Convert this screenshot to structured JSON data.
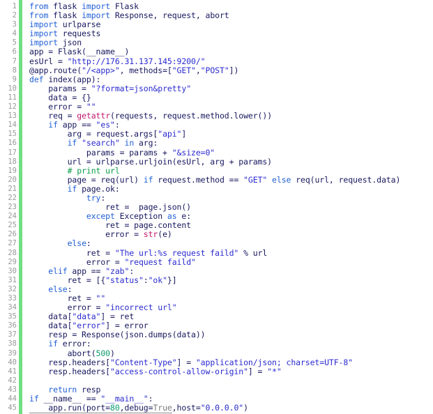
{
  "window": {
    "title": "flask app.py",
    "language": "Python",
    "theme": "light",
    "colors": {
      "background": "#ffffff",
      "gutter_text": "#999999",
      "change_marker": "#6ee083",
      "keyword": "#1f5fd6",
      "builtin": "#c2176b",
      "string": "#2a2ad0",
      "number": "#0b9d6e",
      "comment": "#0b9d4a",
      "constant": "#7a7a7a",
      "plain": "#17175e"
    }
  },
  "editor": {
    "first_line_number": 1,
    "last_line_number": 45,
    "total_lines": 45,
    "line_numbers": [
      "1",
      "2",
      "3",
      "4",
      "5",
      "6",
      "7",
      "8",
      "9",
      "10",
      "11",
      "12",
      "13",
      "14",
      "15",
      "16",
      "17",
      "18",
      "19",
      "20",
      "21",
      "22",
      "23",
      "24",
      "25",
      "26",
      "27",
      "28",
      "29",
      "30",
      "31",
      "32",
      "33",
      "34",
      "35",
      "36",
      "37",
      "38",
      "39",
      "40",
      "41",
      "42",
      "43",
      "44",
      "45"
    ],
    "lines": [
      "from flask import Flask",
      "from flask import Response, request, abort",
      "import urlparse",
      "import requests",
      "import json",
      "app = Flask(__name__)",
      "esUrl = \"http://176.31.137.145:9200/\"",
      "@app.route(\"/<app>\", methods=[\"GET\",\"POST\"])",
      "def index(app):",
      "    params = \"?format=json&pretty\"",
      "    data = {}",
      "    error = \"\"",
      "    req = getattr(requests, request.method.lower())",
      "    if app == \"es\":",
      "        arg = request.args[\"api\"]",
      "        if \"search\" in arg:",
      "            params = params + \"&size=0\"",
      "        url = urlparse.urljoin(esUrl, arg + params)",
      "        # print url",
      "        page = req(url) if request.method == \"GET\" else req(url, request.data)",
      "        if page.ok:",
      "            try:",
      "                ret =  page.json()",
      "            except Exception as e:",
      "                ret = page.content",
      "                error = str(e)",
      "        else:",
      "            ret = \"The url:%s request faild\" % url",
      "            error = \"request faild\"",
      "    elif app == \"zab\":",
      "        ret = [{\"status\":\"ok\"}]",
      "    else:",
      "        ret = \"\"",
      "        error = \"incorrect url\"",
      "    data[\"data\"] = ret",
      "    data[\"error\"] = error",
      "    resp = Response(json.dumps(data))",
      "    if error:",
      "        abort(500)",
      "    resp.headers[\"Content-Type\"] = \"application/json; charset=UTF-8\"",
      "    resp.headers[\"access-control-allow-origin\"] = \"*\"",
      "",
      "    return resp",
      "if __name__ == \"__main__\":",
      "    app.run(port=80,debug=True,host=\"0.0.0.0\")"
    ]
  }
}
